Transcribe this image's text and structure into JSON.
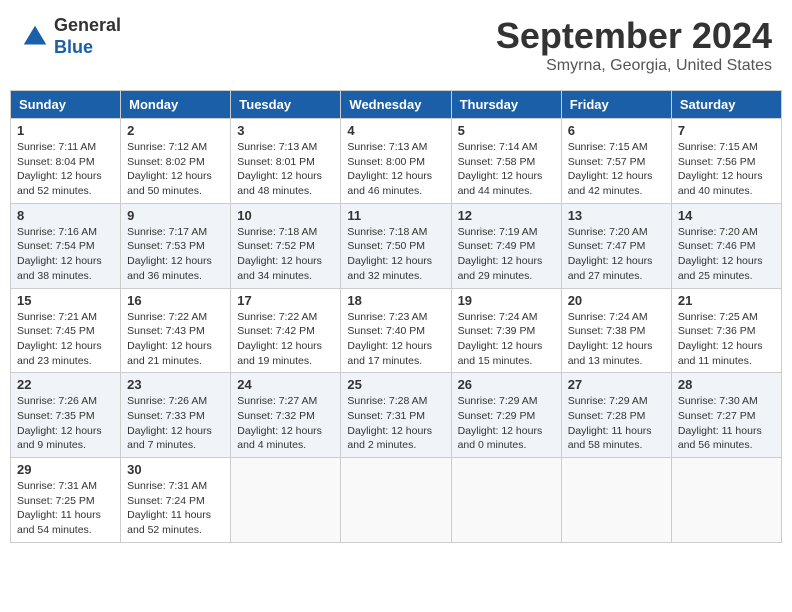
{
  "header": {
    "logo": {
      "general": "General",
      "blue": "Blue"
    },
    "title": "September 2024",
    "subtitle": "Smyrna, Georgia, United States"
  },
  "calendar": {
    "days_of_week": [
      "Sunday",
      "Monday",
      "Tuesday",
      "Wednesday",
      "Thursday",
      "Friday",
      "Saturday"
    ],
    "weeks": [
      [
        {
          "day": "1",
          "sunrise": "Sunrise: 7:11 AM",
          "sunset": "Sunset: 8:04 PM",
          "daylight": "Daylight: 12 hours and 52 minutes."
        },
        {
          "day": "2",
          "sunrise": "Sunrise: 7:12 AM",
          "sunset": "Sunset: 8:02 PM",
          "daylight": "Daylight: 12 hours and 50 minutes."
        },
        {
          "day": "3",
          "sunrise": "Sunrise: 7:13 AM",
          "sunset": "Sunset: 8:01 PM",
          "daylight": "Daylight: 12 hours and 48 minutes."
        },
        {
          "day": "4",
          "sunrise": "Sunrise: 7:13 AM",
          "sunset": "Sunset: 8:00 PM",
          "daylight": "Daylight: 12 hours and 46 minutes."
        },
        {
          "day": "5",
          "sunrise": "Sunrise: 7:14 AM",
          "sunset": "Sunset: 7:58 PM",
          "daylight": "Daylight: 12 hours and 44 minutes."
        },
        {
          "day": "6",
          "sunrise": "Sunrise: 7:15 AM",
          "sunset": "Sunset: 7:57 PM",
          "daylight": "Daylight: 12 hours and 42 minutes."
        },
        {
          "day": "7",
          "sunrise": "Sunrise: 7:15 AM",
          "sunset": "Sunset: 7:56 PM",
          "daylight": "Daylight: 12 hours and 40 minutes."
        }
      ],
      [
        {
          "day": "8",
          "sunrise": "Sunrise: 7:16 AM",
          "sunset": "Sunset: 7:54 PM",
          "daylight": "Daylight: 12 hours and 38 minutes."
        },
        {
          "day": "9",
          "sunrise": "Sunrise: 7:17 AM",
          "sunset": "Sunset: 7:53 PM",
          "daylight": "Daylight: 12 hours and 36 minutes."
        },
        {
          "day": "10",
          "sunrise": "Sunrise: 7:18 AM",
          "sunset": "Sunset: 7:52 PM",
          "daylight": "Daylight: 12 hours and 34 minutes."
        },
        {
          "day": "11",
          "sunrise": "Sunrise: 7:18 AM",
          "sunset": "Sunset: 7:50 PM",
          "daylight": "Daylight: 12 hours and 32 minutes."
        },
        {
          "day": "12",
          "sunrise": "Sunrise: 7:19 AM",
          "sunset": "Sunset: 7:49 PM",
          "daylight": "Daylight: 12 hours and 29 minutes."
        },
        {
          "day": "13",
          "sunrise": "Sunrise: 7:20 AM",
          "sunset": "Sunset: 7:47 PM",
          "daylight": "Daylight: 12 hours and 27 minutes."
        },
        {
          "day": "14",
          "sunrise": "Sunrise: 7:20 AM",
          "sunset": "Sunset: 7:46 PM",
          "daylight": "Daylight: 12 hours and 25 minutes."
        }
      ],
      [
        {
          "day": "15",
          "sunrise": "Sunrise: 7:21 AM",
          "sunset": "Sunset: 7:45 PM",
          "daylight": "Daylight: 12 hours and 23 minutes."
        },
        {
          "day": "16",
          "sunrise": "Sunrise: 7:22 AM",
          "sunset": "Sunset: 7:43 PM",
          "daylight": "Daylight: 12 hours and 21 minutes."
        },
        {
          "day": "17",
          "sunrise": "Sunrise: 7:22 AM",
          "sunset": "Sunset: 7:42 PM",
          "daylight": "Daylight: 12 hours and 19 minutes."
        },
        {
          "day": "18",
          "sunrise": "Sunrise: 7:23 AM",
          "sunset": "Sunset: 7:40 PM",
          "daylight": "Daylight: 12 hours and 17 minutes."
        },
        {
          "day": "19",
          "sunrise": "Sunrise: 7:24 AM",
          "sunset": "Sunset: 7:39 PM",
          "daylight": "Daylight: 12 hours and 15 minutes."
        },
        {
          "day": "20",
          "sunrise": "Sunrise: 7:24 AM",
          "sunset": "Sunset: 7:38 PM",
          "daylight": "Daylight: 12 hours and 13 minutes."
        },
        {
          "day": "21",
          "sunrise": "Sunrise: 7:25 AM",
          "sunset": "Sunset: 7:36 PM",
          "daylight": "Daylight: 12 hours and 11 minutes."
        }
      ],
      [
        {
          "day": "22",
          "sunrise": "Sunrise: 7:26 AM",
          "sunset": "Sunset: 7:35 PM",
          "daylight": "Daylight: 12 hours and 9 minutes."
        },
        {
          "day": "23",
          "sunrise": "Sunrise: 7:26 AM",
          "sunset": "Sunset: 7:33 PM",
          "daylight": "Daylight: 12 hours and 7 minutes."
        },
        {
          "day": "24",
          "sunrise": "Sunrise: 7:27 AM",
          "sunset": "Sunset: 7:32 PM",
          "daylight": "Daylight: 12 hours and 4 minutes."
        },
        {
          "day": "25",
          "sunrise": "Sunrise: 7:28 AM",
          "sunset": "Sunset: 7:31 PM",
          "daylight": "Daylight: 12 hours and 2 minutes."
        },
        {
          "day": "26",
          "sunrise": "Sunrise: 7:29 AM",
          "sunset": "Sunset: 7:29 PM",
          "daylight": "Daylight: 12 hours and 0 minutes."
        },
        {
          "day": "27",
          "sunrise": "Sunrise: 7:29 AM",
          "sunset": "Sunset: 7:28 PM",
          "daylight": "Daylight: 11 hours and 58 minutes."
        },
        {
          "day": "28",
          "sunrise": "Sunrise: 7:30 AM",
          "sunset": "Sunset: 7:27 PM",
          "daylight": "Daylight: 11 hours and 56 minutes."
        }
      ],
      [
        {
          "day": "29",
          "sunrise": "Sunrise: 7:31 AM",
          "sunset": "Sunset: 7:25 PM",
          "daylight": "Daylight: 11 hours and 54 minutes."
        },
        {
          "day": "30",
          "sunrise": "Sunrise: 7:31 AM",
          "sunset": "Sunset: 7:24 PM",
          "daylight": "Daylight: 11 hours and 52 minutes."
        },
        {
          "day": "",
          "sunrise": "",
          "sunset": "",
          "daylight": ""
        },
        {
          "day": "",
          "sunrise": "",
          "sunset": "",
          "daylight": ""
        },
        {
          "day": "",
          "sunrise": "",
          "sunset": "",
          "daylight": ""
        },
        {
          "day": "",
          "sunrise": "",
          "sunset": "",
          "daylight": ""
        },
        {
          "day": "",
          "sunrise": "",
          "sunset": "",
          "daylight": ""
        }
      ]
    ]
  }
}
